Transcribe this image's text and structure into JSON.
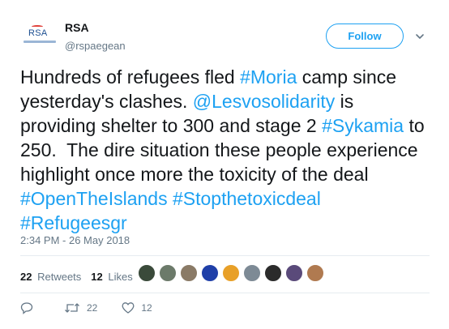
{
  "account": {
    "avatar_text": "RSA",
    "display_name": "RSA",
    "handle": "@rspaegean",
    "follow_label": "Follow"
  },
  "tweet": {
    "segments": [
      {
        "text": "Hundreds of refugees fled ",
        "link": false
      },
      {
        "text": "#Moria",
        "link": true
      },
      {
        "text": " camp since yesterday's clashes. ",
        "link": false
      },
      {
        "text": "@Lesvosolidarity",
        "link": true
      },
      {
        "text": " is providing shelter to 300 and stage 2 ",
        "link": false
      },
      {
        "text": "#Sykamia",
        "link": true
      },
      {
        "text": " to 250.  The dire situation these people experience highlight once more the toxicity of the deal ",
        "link": false
      },
      {
        "text": "#OpenTheIslands",
        "link": true
      },
      {
        "text": " ",
        "link": false
      },
      {
        "text": "#Stopthetoxicdeal",
        "link": true
      },
      {
        "text": " ",
        "link": false
      },
      {
        "text": "#Refugeesgr",
        "link": true
      }
    ],
    "timestamp": "2:34 PM - 26 May 2018"
  },
  "stats": {
    "retweets_count": "22",
    "retweets_label": "Retweets",
    "likes_count": "12",
    "likes_label": "Likes",
    "liker_avatar_colors": [
      "#3a4a3a",
      "#6c7a6a",
      "#8a7a66",
      "#1f3fa8",
      "#e8a028",
      "#7d8a95",
      "#2b2b2b",
      "#5a4a7a",
      "#b07a50"
    ]
  },
  "actions": {
    "reply_count": "",
    "retweet_count": "22",
    "like_count": "12"
  },
  "colors": {
    "accent": "#1da1f2",
    "text": "#14171a",
    "muted": "#657786",
    "divider": "#e6ecf0"
  }
}
